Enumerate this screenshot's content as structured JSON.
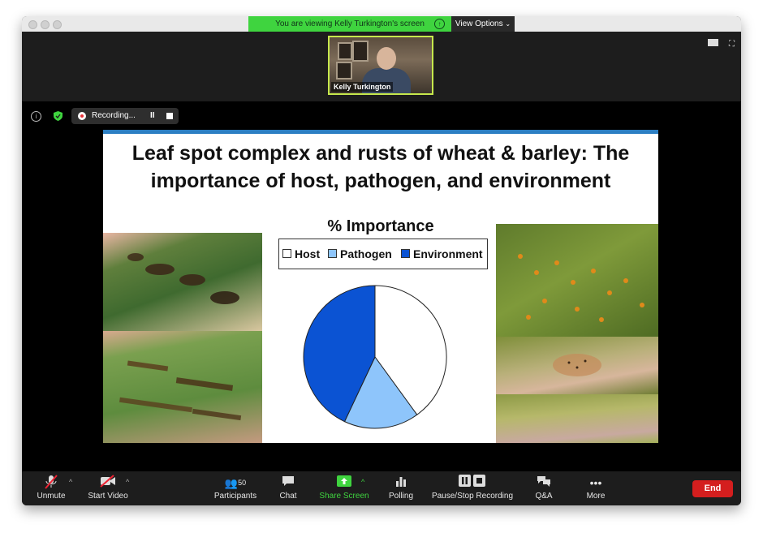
{
  "banner": {
    "text": "You are viewing Kelly Turkington's screen",
    "view_options": "View Options"
  },
  "video": {
    "participant_name": "Kelly Turkington"
  },
  "recording": {
    "label": "Recording...",
    "pause_glyph": "II"
  },
  "slide": {
    "title_line1": "Leaf spot complex and rusts of wheat & barley: The",
    "title_line2": "importance of host, pathogen, and environment",
    "chart_heading": "% Importance",
    "legend": [
      "Host",
      "Pathogen",
      "Environment"
    ]
  },
  "chart_data": {
    "type": "pie",
    "title": "% Importance",
    "categories": [
      "Host",
      "Pathogen",
      "Environment"
    ],
    "values": [
      40,
      17,
      43
    ],
    "colors": [
      "#ffffff",
      "#8ec5fb",
      "#0b53d3"
    ],
    "legend_position": "top"
  },
  "toolbar": {
    "unmute": "Unmute",
    "start_video": "Start Video",
    "participants": "Participants",
    "participants_count": "50",
    "chat": "Chat",
    "share_screen": "Share Screen",
    "polling": "Polling",
    "pause_stop_recording": "Pause/Stop Recording",
    "qa": "Q&A",
    "more": "More",
    "end": "End"
  },
  "icons": {
    "mic": "mic-muted-icon",
    "video": "video-off-icon",
    "participants": "participants-icon",
    "chat": "chat-bubble-icon",
    "share": "share-arrow-icon",
    "polling": "bar-chart-icon",
    "recording": "pause-stop-icon",
    "qa": "qa-bubbles-icon",
    "more": "ellipsis-icon"
  },
  "colors": {
    "share_green": "#3fd43f",
    "end_red": "#d41e1e",
    "slide_accent": "#2c7fc3"
  }
}
